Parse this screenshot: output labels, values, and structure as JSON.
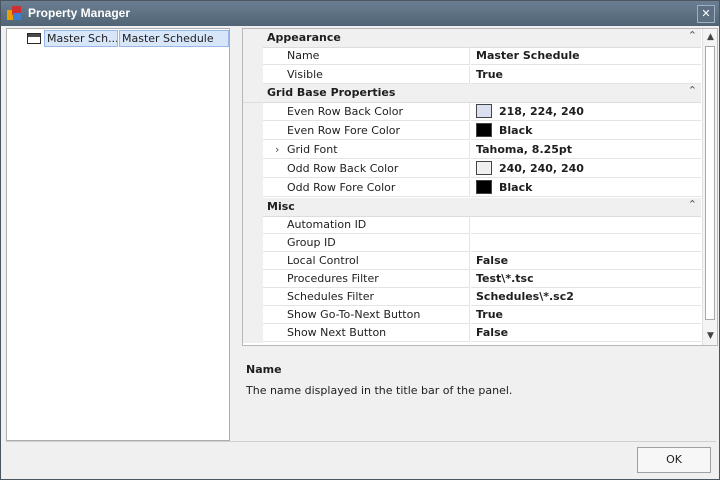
{
  "window": {
    "title": "Property Manager",
    "close_glyph": "✕"
  },
  "tree": {
    "items": [
      {
        "icon": "panel-icon",
        "label": "Master Sch...",
        "value": "Master Schedule"
      }
    ]
  },
  "grid": {
    "categories": [
      {
        "label": "Appearance",
        "properties": [
          {
            "name": "Name",
            "value": "Master Schedule"
          },
          {
            "name": "Visible",
            "value": "True"
          }
        ]
      },
      {
        "label": "Grid Base Properties",
        "properties": [
          {
            "name": "Even Row Back Color",
            "value": "218, 224, 240",
            "swatch": "#dae0f0"
          },
          {
            "name": "Even Row Fore Color",
            "value": "Black",
            "swatch": "#000000"
          },
          {
            "name": "Grid Font",
            "value": "Tahoma, 8.25pt",
            "expandable": true
          },
          {
            "name": "Odd Row Back Color",
            "value": "240, 240, 240",
            "swatch": "#f0f0f0"
          },
          {
            "name": "Odd Row Fore Color",
            "value": "Black",
            "swatch": "#000000"
          }
        ]
      },
      {
        "label": "Misc",
        "properties": [
          {
            "name": "Automation ID",
            "value": ""
          },
          {
            "name": "Group ID",
            "value": ""
          },
          {
            "name": "Local Control",
            "value": "False"
          },
          {
            "name": "Procedures Filter",
            "value": "Test\\*.tsc"
          },
          {
            "name": "Schedules Filter",
            "value": "Schedules\\*.sc2"
          },
          {
            "name": "Show Go-To-Next Button",
            "value": "True"
          },
          {
            "name": "Show Next Button",
            "value": "False"
          }
        ]
      }
    ]
  },
  "description": {
    "title": "Name",
    "text": "The name displayed in the title bar of the panel."
  },
  "footer": {
    "ok_label": "OK"
  }
}
